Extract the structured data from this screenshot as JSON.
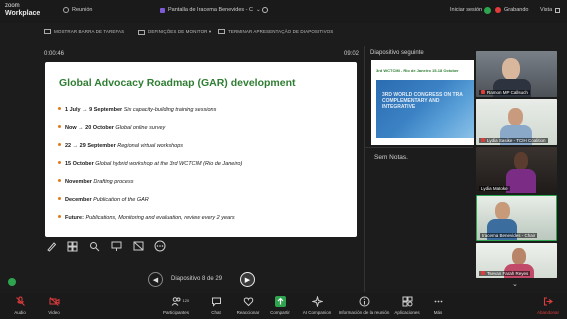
{
  "app": {
    "logo_line1": "zoom",
    "logo_line2": "Workplace",
    "nav_meeting": "Reunión",
    "share_tab": "Pantalla de Iracema Benevides - C",
    "sign_in": "Iniciar sesión",
    "recording": "Grabando",
    "view": "Vista"
  },
  "presenter_toolbar": {
    "show_taskbar": "MOSTRAR BARRA DE TAREFAS",
    "display_settings": "DEFINIÇÕES DE MONITOR ▾",
    "end_presentation": "TERMINAR APRESENTAÇÃO DE DIAPOSITIVOS"
  },
  "presenter": {
    "timer": "0:00:46",
    "clock": "09:02",
    "slide_nav_label": "Diapositivo 8 de 29",
    "next_slide_label": "Diapositivo seguinte",
    "notes": "Sem Notas."
  },
  "slide": {
    "title": "Global Advocacy Roadmap (GAR) development",
    "bullets": [
      {
        "bold": "1 July → 9 September",
        "italic": " Six capacity-building training sessions"
      },
      {
        "bold": "Now → 20 October",
        "italic": " Global online survey"
      },
      {
        "bold": "22 → 29 September",
        "italic": " Regional virtual workshops"
      },
      {
        "bold": "15 October",
        "italic": " Global hybrid workshop at the 3rd WCTCIM (Rio de Janeiro)"
      },
      {
        "bold": "November",
        "italic": " Drafting process"
      },
      {
        "bold": "December",
        "italic": " Publication of the GAR"
      },
      {
        "bold": "Future:",
        "italic": " Publications, Monitoring and evaluation, review every 2 years"
      }
    ]
  },
  "next_slide": {
    "heading": "3rd WCTCIM - Rio de Janeiro 15-18 October",
    "image_text": "3RD WORLD CONGRESS ON TRA COMPLEMENTARY AND INTEGRATIVE"
  },
  "participants": [
    {
      "name": "Ramon MP Callsuch"
    },
    {
      "name": "Lydia Sasike - TCIH Coalition"
    },
    {
      "name": "Lydia Matoke"
    },
    {
      "name": "Iracema Benevides - Chair"
    },
    {
      "name": "Tsevan Farah Reyes"
    }
  ],
  "bottom_bar": {
    "audio": "Audio",
    "video": "Video",
    "participants": "Participantes",
    "participants_count": "120",
    "chat": "Chat",
    "react": "Reaccionar",
    "share": "Compartir",
    "companion": "AI Companion",
    "meeting_info": "Información de la reunión",
    "apps": "Aplicaciones",
    "more": "Más",
    "leave": "Abandonar"
  },
  "colors": {
    "title_green": "#2e7d32",
    "bullet_orange": "#e07a1f",
    "share_green": "#2ea44f",
    "leave_red": "#e03c3c"
  }
}
